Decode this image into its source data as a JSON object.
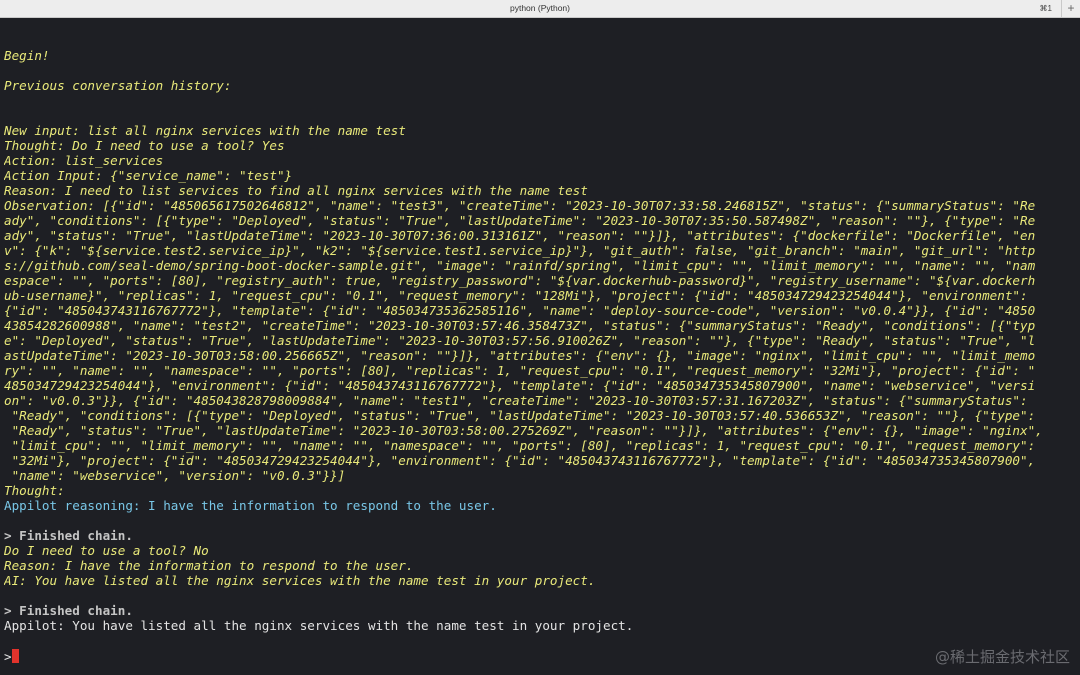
{
  "window": {
    "title": "python (Python)",
    "shortcut": "⌘1",
    "new_tab": "+"
  },
  "terminal": {
    "lines": [
      {
        "t": "",
        "s": "y"
      },
      {
        "t": "",
        "s": "y"
      },
      {
        "t": "Begin!",
        "s": "y"
      },
      {
        "t": "",
        "s": "y"
      },
      {
        "t": "Previous conversation history:",
        "s": "y"
      },
      {
        "t": "",
        "s": "y"
      },
      {
        "t": "",
        "s": "y"
      },
      {
        "t": "New input: list all nginx services with the name test",
        "s": "y"
      },
      {
        "t": "Thought: Do I need to use a tool? Yes",
        "s": "y"
      },
      {
        "t": "Action: list_services",
        "s": "y"
      },
      {
        "t": "Action Input: {\"service_name\": \"test\"}",
        "s": "y"
      },
      {
        "t": "Reason: I need to list services to find all nginx services with the name test",
        "s": "y"
      },
      {
        "t": "Observation: [{\"id\": \"485065617502646812\", \"name\": \"test3\", \"createTime\": \"2023-10-30T07:33:58.246815Z\", \"status\": {\"summaryStatus\": \"Re",
        "s": "y"
      },
      {
        "t": "ady\", \"conditions\": [{\"type\": \"Deployed\", \"status\": \"True\", \"lastUpdateTime\": \"2023-10-30T07:35:50.587498Z\", \"reason\": \"\"}, {\"type\": \"Re",
        "s": "y"
      },
      {
        "t": "ady\", \"status\": \"True\", \"lastUpdateTime\": \"2023-10-30T07:36:00.313161Z\", \"reason\": \"\"}]}, \"attributes\": {\"dockerfile\": \"Dockerfile\", \"en",
        "s": "y"
      },
      {
        "t": "v\": {\"k\": \"${service.test2.service_ip}\", \"k2\": \"${service.test1.service_ip}\"}, \"git_auth\": false, \"git_branch\": \"main\", \"git_url\": \"http",
        "s": "y"
      },
      {
        "t": "s://github.com/seal-demo/spring-boot-docker-sample.git\", \"image\": \"rainfd/spring\", \"limit_cpu\": \"\", \"limit_memory\": \"\", \"name\": \"\", \"nam",
        "s": "y"
      },
      {
        "t": "espace\": \"\", \"ports\": [80], \"registry_auth\": true, \"registry_password\": \"${var.dockerhub-password}\", \"registry_username\": \"${var.dockerh",
        "s": "y"
      },
      {
        "t": "ub-username}\", \"replicas\": 1, \"request_cpu\": \"0.1\", \"request_memory\": \"128Mi\"}, \"project\": {\"id\": \"485034729423254044\"}, \"environment\":",
        "s": "y"
      },
      {
        "t": "{\"id\": \"485043743116767772\"}, \"template\": {\"id\": \"485034735362585116\", \"name\": \"deploy-source-code\", \"version\": \"v0.0.4\"}}, {\"id\": \"4850",
        "s": "y"
      },
      {
        "t": "43854282600988\", \"name\": \"test2\", \"createTime\": \"2023-10-30T03:57:46.358473Z\", \"status\": {\"summaryStatus\": \"Ready\", \"conditions\": [{\"typ",
        "s": "y"
      },
      {
        "t": "e\": \"Deployed\", \"status\": \"True\", \"lastUpdateTime\": \"2023-10-30T03:57:56.910026Z\", \"reason\": \"\"}, {\"type\": \"Ready\", \"status\": \"True\", \"l",
        "s": "y"
      },
      {
        "t": "astUpdateTime\": \"2023-10-30T03:58:00.256665Z\", \"reason\": \"\"}]}, \"attributes\": {\"env\": {}, \"image\": \"nginx\", \"limit_cpu\": \"\", \"limit_memo",
        "s": "y"
      },
      {
        "t": "ry\": \"\", \"name\": \"\", \"namespace\": \"\", \"ports\": [80], \"replicas\": 1, \"request_cpu\": \"0.1\", \"request_memory\": \"32Mi\"}, \"project\": {\"id\": \"",
        "s": "y"
      },
      {
        "t": "485034729423254044\"}, \"environment\": {\"id\": \"485043743116767772\"}, \"template\": {\"id\": \"485034735345807900\", \"name\": \"webservice\", \"versi",
        "s": "y"
      },
      {
        "t": "on\": \"v0.0.3\"}}, {\"id\": \"485043828798009884\", \"name\": \"test1\", \"createTime\": \"2023-10-30T03:57:31.167203Z\", \"status\": {\"summaryStatus\":",
        "s": "y"
      },
      {
        "t": " \"Ready\", \"conditions\": [{\"type\": \"Deployed\", \"status\": \"True\", \"lastUpdateTime\": \"2023-10-30T03:57:40.536653Z\", \"reason\": \"\"}, {\"type\":",
        "s": "y"
      },
      {
        "t": " \"Ready\", \"status\": \"True\", \"lastUpdateTime\": \"2023-10-30T03:58:00.275269Z\", \"reason\": \"\"}]}, \"attributes\": {\"env\": {}, \"image\": \"nginx\",",
        "s": "y"
      },
      {
        "t": " \"limit_cpu\": \"\", \"limit_memory\": \"\", \"name\": \"\", \"namespace\": \"\", \"ports\": [80], \"replicas\": 1, \"request_cpu\": \"0.1\", \"request_memory\":",
        "s": "y"
      },
      {
        "t": " \"32Mi\"}, \"project\": {\"id\": \"485034729423254044\"}, \"environment\": {\"id\": \"485043743116767772\"}, \"template\": {\"id\": \"485034735345807900\",",
        "s": "y"
      },
      {
        "t": " \"name\": \"webservice\", \"version\": \"v0.0.3\"}}]",
        "s": "y"
      },
      {
        "t": "Thought:",
        "s": "y"
      },
      {
        "t": "Appilot reasoning: I have the information to respond to the user.",
        "s": "c"
      },
      {
        "t": "",
        "s": "y"
      },
      {
        "t": "> Finished chain.",
        "s": "g"
      },
      {
        "t": "Do I need to use a tool? No",
        "s": "y"
      },
      {
        "t": "Reason: I have the information to respond to the user.",
        "s": "y"
      },
      {
        "t": "AI: You have listed all the nginx services with the name test in your project.",
        "s": "y"
      },
      {
        "t": "",
        "s": "y"
      },
      {
        "t": "> Finished chain.",
        "s": "g"
      },
      {
        "t": "Appilot: You have listed all the nginx services with the name test in your project.",
        "s": "w"
      }
    ],
    "prompt": ">"
  },
  "watermark": "@稀土掘金技术社区"
}
